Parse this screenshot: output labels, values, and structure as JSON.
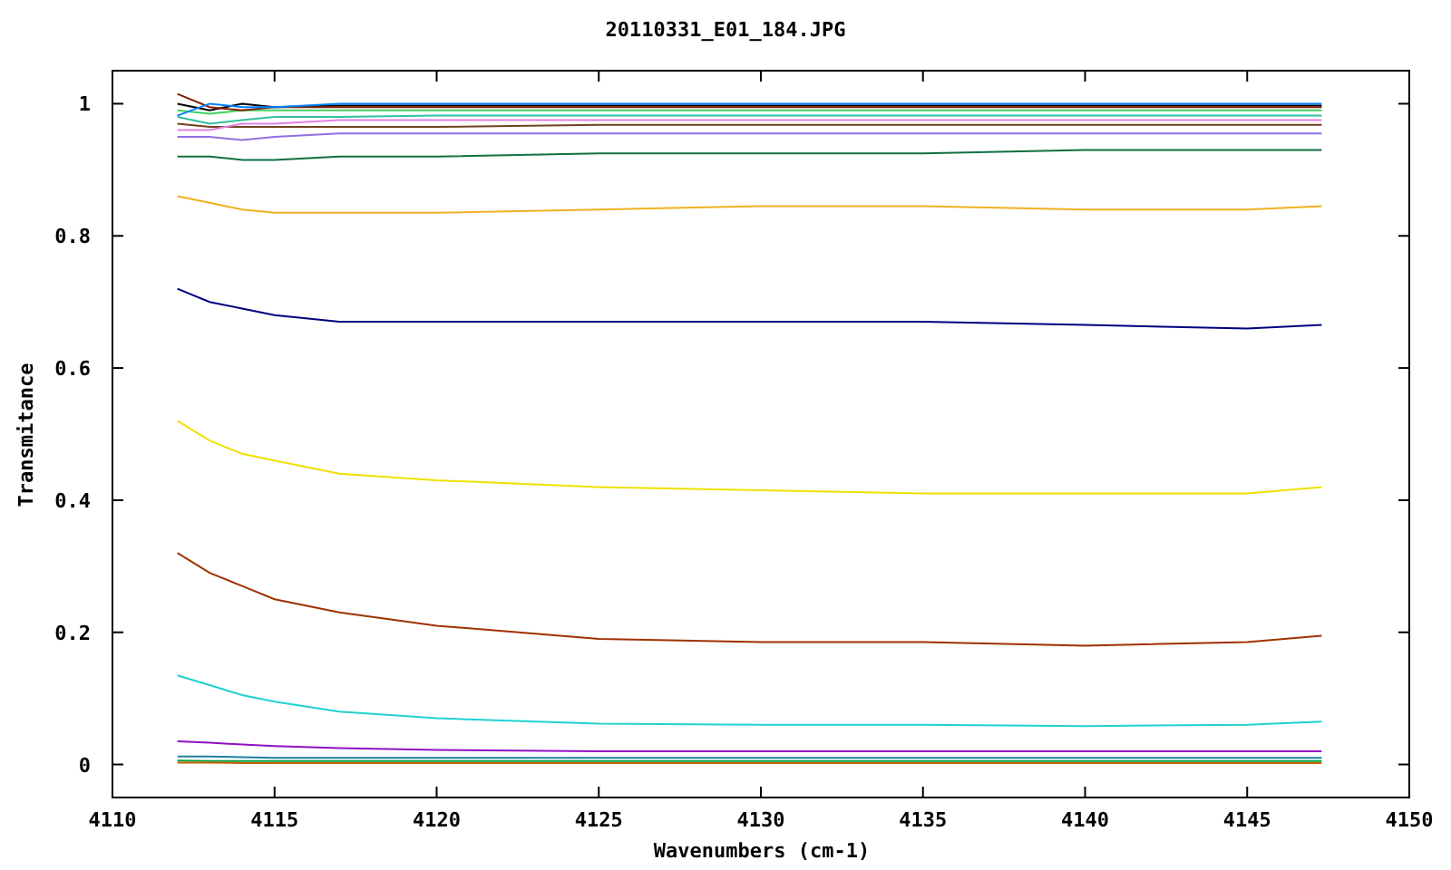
{
  "chart": {
    "chart_data": {
      "type": "line",
      "title": "20110331_E01_184.JPG",
      "xlabel": "Wavenumbers (cm-1)",
      "ylabel": "Transmitance",
      "x": [
        4112,
        4113,
        4114,
        4115,
        4117,
        4120,
        4125,
        4130,
        4135,
        4140,
        4145,
        4147.3
      ],
      "xlim": [
        4110,
        4150
      ],
      "ylim": [
        -0.05,
        1.05
      ],
      "xticks": [
        4110,
        4115,
        4120,
        4125,
        4130,
        4135,
        4140,
        4145,
        4150
      ],
      "yticks": [
        0,
        0.2,
        0.4,
        0.6,
        0.8,
        1
      ],
      "series": [
        {
          "color": "#000080",
          "values": [
            0.72,
            0.7,
            0.69,
            0.68,
            0.67,
            0.67,
            0.67,
            0.67,
            0.67,
            0.665,
            0.66,
            0.665
          ]
        },
        {
          "color": "#f0e000",
          "values": [
            0.52,
            0.49,
            0.47,
            0.46,
            0.44,
            0.43,
            0.42,
            0.415,
            0.41,
            0.41,
            0.41,
            0.42
          ]
        },
        {
          "color": "#a03000",
          "values": [
            0.32,
            0.29,
            0.27,
            0.25,
            0.23,
            0.21,
            0.19,
            0.185,
            0.185,
            0.18,
            0.185,
            0.195
          ]
        },
        {
          "color": "#20d0d0",
          "values": [
            0.135,
            0.12,
            0.105,
            0.095,
            0.08,
            0.07,
            0.062,
            0.06,
            0.06,
            0.058,
            0.06,
            0.065
          ]
        },
        {
          "color": "#9010c0",
          "values": [
            0.035,
            0.033,
            0.03,
            0.028,
            0.025,
            0.022,
            0.02,
            0.02,
            0.02,
            0.02,
            0.02,
            0.02
          ]
        },
        {
          "color": "#2080a0",
          "values": [
            0.012,
            0.012,
            0.011,
            0.01,
            0.01,
            0.01,
            0.01,
            0.01,
            0.01,
            0.01,
            0.01,
            0.01
          ]
        },
        {
          "color": "#00a040",
          "values": [
            0.006,
            0.005,
            0.005,
            0.005,
            0.005,
            0.005,
            0.005,
            0.005,
            0.005,
            0.005,
            0.005,
            0.005
          ]
        },
        {
          "color": "#c06000",
          "values": [
            0.003,
            0.003,
            0.002,
            0.002,
            0.002,
            0.002,
            0.002,
            0.002,
            0.002,
            0.002,
            0.002,
            0.002
          ]
        },
        {
          "color": "#f0b020",
          "values": [
            0.86,
            0.85,
            0.84,
            0.835,
            0.835,
            0.835,
            0.84,
            0.845,
            0.845,
            0.84,
            0.84,
            0.845
          ]
        },
        {
          "color": "#107040",
          "values": [
            0.92,
            0.92,
            0.915,
            0.915,
            0.92,
            0.92,
            0.925,
            0.925,
            0.925,
            0.93,
            0.93,
            0.93
          ]
        },
        {
          "color": "#9070e0",
          "values": [
            0.95,
            0.95,
            0.945,
            0.95,
            0.955,
            0.955,
            0.955,
            0.955,
            0.955,
            0.955,
            0.955,
            0.955
          ]
        },
        {
          "color": "#704020",
          "values": [
            0.97,
            0.965,
            0.965,
            0.965,
            0.965,
            0.965,
            0.968,
            0.968,
            0.968,
            0.968,
            0.968,
            0.968
          ]
        },
        {
          "color": "#e080e0",
          "values": [
            0.96,
            0.96,
            0.97,
            0.97,
            0.975,
            0.975,
            0.975,
            0.975,
            0.975,
            0.975,
            0.975,
            0.975
          ]
        },
        {
          "color": "#30c0a0",
          "values": [
            0.98,
            0.97,
            0.975,
            0.98,
            0.98,
            0.982,
            0.982,
            0.982,
            0.982,
            0.982,
            0.982,
            0.982
          ]
        },
        {
          "color": "#40d060",
          "values": [
            0.99,
            0.985,
            0.99,
            0.99,
            0.99,
            0.99,
            0.99,
            0.99,
            0.99,
            0.99,
            0.99,
            0.99
          ]
        },
        {
          "color": "#000000",
          "values": [
            1.0,
            0.99,
            1.0,
            0.995,
            0.997,
            0.997,
            0.997,
            0.997,
            0.997,
            0.997,
            0.997,
            0.997
          ]
        },
        {
          "color": "#802000",
          "values": [
            1.015,
            0.995,
            0.99,
            0.995,
            0.995,
            0.995,
            0.995,
            0.995,
            0.995,
            0.995,
            0.995,
            0.995
          ]
        },
        {
          "color": "#0080ff",
          "values": [
            0.982,
            1.0,
            0.995,
            0.995,
            1.0,
            1.0,
            1.0,
            1.0,
            1.0,
            1.0,
            1.0,
            1.0
          ]
        }
      ]
    }
  }
}
